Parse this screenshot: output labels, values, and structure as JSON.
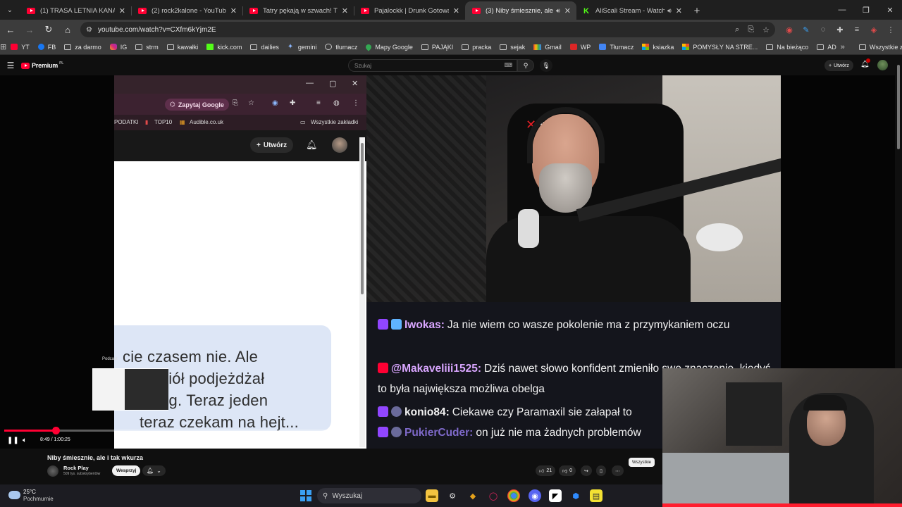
{
  "browser": {
    "tabs": [
      {
        "title": "(1) TRASA LETNIA KANAŁU ZERO",
        "icon": "youtube-icon"
      },
      {
        "title": "(2) rock2kalone - YouTube",
        "icon": "youtube-icon"
      },
      {
        "title": "Tatry pękają w szwach! Tłumy tu",
        "icon": "youtube-icon"
      },
      {
        "title": "Pajalockk | Drunk Gotowanie z A",
        "icon": "youtube-icon"
      },
      {
        "title": "(3) Niby śmiesznie, ale i tak",
        "icon": "youtube-icon",
        "active": true,
        "audio": true
      },
      {
        "title": "AliScali Stream - Watch Live",
        "icon": "kick-icon",
        "audio": true
      }
    ],
    "new_tab": "+",
    "url": "youtube.com/watch?v=CXfm6kYjm2E",
    "bookmarks": [
      {
        "label": "YT",
        "icon": "youtube-icon"
      },
      {
        "label": "FB",
        "icon": "facebook-icon"
      },
      {
        "label": "za darmo",
        "icon": "folder-icon"
      },
      {
        "label": "IG",
        "icon": "instagram-icon"
      },
      {
        "label": "strm",
        "icon": "folder-icon"
      },
      {
        "label": "kawałki",
        "icon": "folder-icon"
      },
      {
        "label": "kick.com",
        "icon": "kick-icon"
      },
      {
        "label": "dailies",
        "icon": "folder-icon"
      },
      {
        "label": "gemini",
        "icon": "gemini-icon"
      },
      {
        "label": "tłumacz",
        "icon": "translate-icon"
      },
      {
        "label": "Mapy Google",
        "icon": "maps-icon"
      },
      {
        "label": "PAJĄKI",
        "icon": "folder-icon"
      },
      {
        "label": "pracka",
        "icon": "folder-icon"
      },
      {
        "label": "sejak",
        "icon": "folder-icon"
      },
      {
        "label": "Gmail",
        "icon": "gmail-icon"
      },
      {
        "label": "WP",
        "icon": "wp-icon"
      },
      {
        "label": "Tłumacz",
        "icon": "translate-icon"
      },
      {
        "label": "ksiazka",
        "icon": "folder-icon"
      },
      {
        "label": "POMYSŁY NA STRE...",
        "icon": "office-icon"
      },
      {
        "label": "Na bieżąco",
        "icon": "folder-icon"
      },
      {
        "label": "AD",
        "icon": "folder-icon"
      }
    ],
    "all_bookmarks": "Wszystkie zakładki"
  },
  "youtube": {
    "logo_text": "Premium",
    "logo_sup": "PL",
    "search_placeholder": "Szukaj",
    "create_label": "Utwórz"
  },
  "video_content": {
    "inner_ask_google": "Zapytaj Google",
    "inner_bm_1": "PODATKI",
    "inner_bm_2": "TOP10",
    "inner_bm_3": "Audible.co.uk",
    "inner_all_bookmarks": "Wszystkie zakładki",
    "inner_create": "Utwórz",
    "bubble_lines": [
      "cie czasem nie. Ale",
      "ciół podjeżdżał",
      "rg. Teraz jeden",
      "teraz czekam na hejt..."
    ],
    "cam_brand": "xtb",
    "chat": [
      {
        "platform": "twitch",
        "user": "Iwokas:",
        "user_color": "#d9a6ff",
        "text": "Ja nie wiem co wasze pokolenie ma z przymykaniem oczu"
      },
      {
        "platform": "youtube",
        "user": "@Makaveliii1525:",
        "user_color": "#d9a6ff",
        "text": "Dziś nawet słowo konfident zmieniło swe znaczenie, kiedyś to była największa możliwa obelga"
      },
      {
        "platform": "twitch",
        "user": "konio84:",
        "user_color": "#ffffff",
        "text": "Ciekawe czy Paramaxil sie załapał to"
      },
      {
        "platform": "twitch",
        "user": "PukierCuder:",
        "user_color": "#7e69c9",
        "text": "on już nie ma żadnych problemów"
      }
    ]
  },
  "player": {
    "time": "8:49 / 1:00:25",
    "progress": 0.146,
    "preview_label": "Podcast"
  },
  "below": {
    "title": "Niby śmiesznie, ale i tak wkurza",
    "channel": "Rock Play",
    "subscribers": "509 tys. subskrybentów",
    "support": "Wesprzyj",
    "likes": "21",
    "dislikes": "0",
    "chip_all": "Wszystkie"
  },
  "taskbar": {
    "temp": "25°C",
    "weather": "Pochmurnie",
    "search": "Wyszukaj"
  }
}
